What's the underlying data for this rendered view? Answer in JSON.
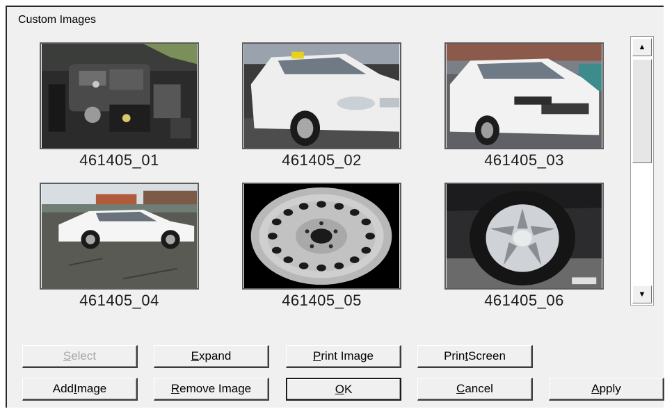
{
  "window": {
    "title": "Custom Images"
  },
  "images": [
    {
      "caption": "461405_01",
      "subject": "engine-bay"
    },
    {
      "caption": "461405_02",
      "subject": "white-sedan-front"
    },
    {
      "caption": "461405_03",
      "subject": "white-sedan-front-lot"
    },
    {
      "caption": "461405_04",
      "subject": "white-sedan-side"
    },
    {
      "caption": "461405_05",
      "subject": "steel-wheel"
    },
    {
      "caption": "461405_06",
      "subject": "alloy-wheel"
    }
  ],
  "scrollbar": {
    "up_icon": "arrow-up-icon",
    "down_icon": "arrow-down-icon"
  },
  "buttons": {
    "select": {
      "pre": "",
      "key": "S",
      "post": "elect",
      "enabled": false
    },
    "expand": {
      "pre": "",
      "key": "E",
      "post": "xpand",
      "enabled": true
    },
    "print_image": {
      "pre": "",
      "key": "P",
      "post": "rint Image",
      "enabled": true
    },
    "print_screen": {
      "pre": "Prin",
      "key": "t",
      "post": " Screen",
      "enabled": true
    },
    "add_image": {
      "pre": "Add ",
      "key": "I",
      "post": "mage",
      "enabled": true
    },
    "remove_image": {
      "pre": "",
      "key": "R",
      "post": "emove Image",
      "enabled": true
    },
    "ok": {
      "pre": "",
      "key": "O",
      "post": "K",
      "enabled": true
    },
    "cancel": {
      "pre": "",
      "key": "C",
      "post": "ancel",
      "enabled": true
    },
    "apply": {
      "pre": "",
      "key": "A",
      "post": "pply",
      "enabled": true
    }
  }
}
